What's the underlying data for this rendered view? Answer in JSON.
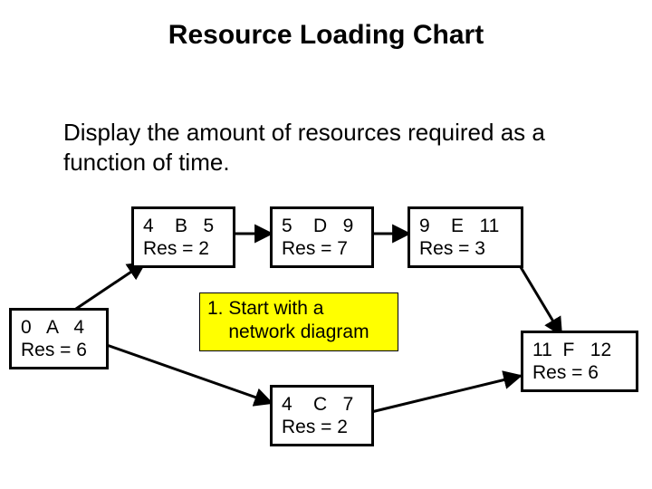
{
  "title": "Resource Loading Chart",
  "subtitle": "Display the amount of resources required as a function of time.",
  "nodes": {
    "A": {
      "row1": "0   A   4",
      "row2": "Res = 6"
    },
    "B": {
      "row1": "4    B   5",
      "row2": "Res = 2"
    },
    "C": {
      "row1": "4    C   7",
      "row2": "Res = 2"
    },
    "D": {
      "row1": "5    D   9",
      "row2": "Res = 7"
    },
    "E": {
      "row1": "9    E   11",
      "row2": "Res = 3"
    },
    "F": {
      "row1": "11  F   12",
      "row2": "Res = 6"
    }
  },
  "callout": {
    "line1": "1. Start with a",
    "line2": "    network diagram"
  },
  "chart_data": {
    "type": "table",
    "title": "Resource Loading Chart",
    "description": "Activity-on-node network diagram showing start time, activity name, finish time, and resource requirement for each activity.",
    "columns": [
      "activity",
      "start",
      "finish",
      "resources"
    ],
    "rows": [
      {
        "activity": "A",
        "start": 0,
        "finish": 4,
        "resources": 6
      },
      {
        "activity": "B",
        "start": 4,
        "finish": 5,
        "resources": 2
      },
      {
        "activity": "C",
        "start": 4,
        "finish": 7,
        "resources": 2
      },
      {
        "activity": "D",
        "start": 5,
        "finish": 9,
        "resources": 7
      },
      {
        "activity": "E",
        "start": 9,
        "finish": 11,
        "resources": 3
      },
      {
        "activity": "F",
        "start": 11,
        "finish": 12,
        "resources": 6
      }
    ],
    "edges": [
      [
        "A",
        "B"
      ],
      [
        "A",
        "C"
      ],
      [
        "B",
        "D"
      ],
      [
        "D",
        "E"
      ],
      [
        "E",
        "F"
      ],
      [
        "C",
        "F"
      ]
    ]
  }
}
